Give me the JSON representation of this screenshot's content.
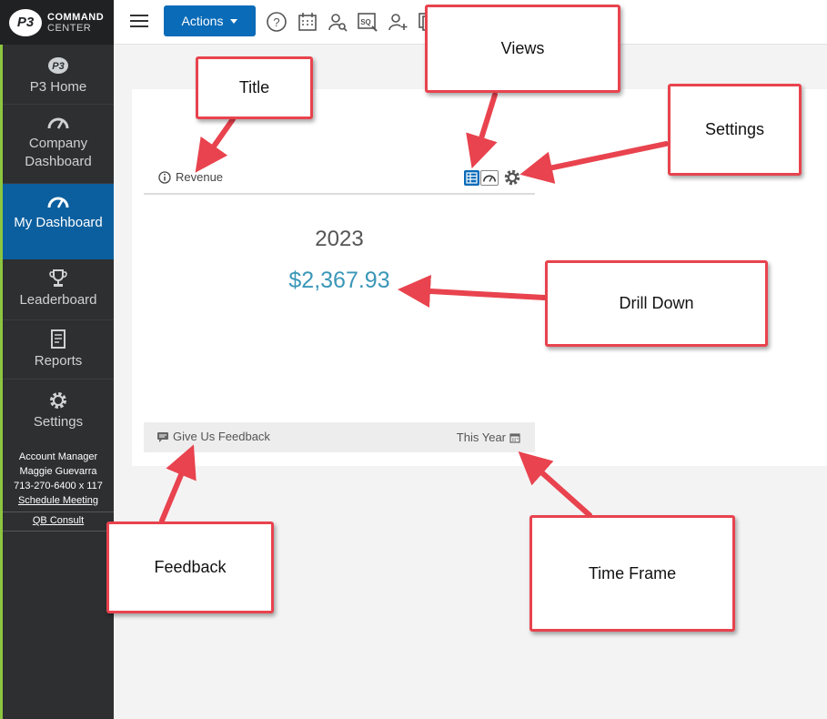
{
  "brand": {
    "logo_text": "P3",
    "line1": "COMMAND",
    "line2": "CENTER"
  },
  "sidebar": {
    "items": [
      {
        "label": "P3 Home"
      },
      {
        "label": "Company Dashboard"
      },
      {
        "label": "My Dashboard",
        "active": true
      },
      {
        "label": "Leaderboard"
      },
      {
        "label": "Reports"
      },
      {
        "label": "Settings"
      }
    ],
    "account": {
      "title": "Account Manager",
      "name": "Maggie Guevarra",
      "phone": "713-270-6400 x 117",
      "schedule_link": "Schedule Meeting"
    },
    "qb_link": "QB Consult"
  },
  "topbar": {
    "actions_label": "Actions",
    "icons": [
      "help-icon",
      "calendar-icon",
      "user-search-icon",
      "sq-search-icon",
      "add-user-icon",
      "copy-icon"
    ]
  },
  "widget": {
    "title": "Revenue",
    "year": "2023",
    "value": "$2,367.93",
    "feedback_label": "Give Us Feedback",
    "timeframe_label": "This Year"
  },
  "callouts": {
    "title": "Title",
    "views": "Views",
    "settings": "Settings",
    "drilldown": "Drill Down",
    "feedback": "Feedback",
    "timeframe": "Time Frame"
  },
  "colors": {
    "sidebar_bg": "#2d2f31",
    "active_nav": "#0c5f9e",
    "actions_button": "#0a6bb8",
    "value_text": "#3a97b8",
    "callout_border": "#e8434e",
    "accent_green": "#8cc63f"
  }
}
